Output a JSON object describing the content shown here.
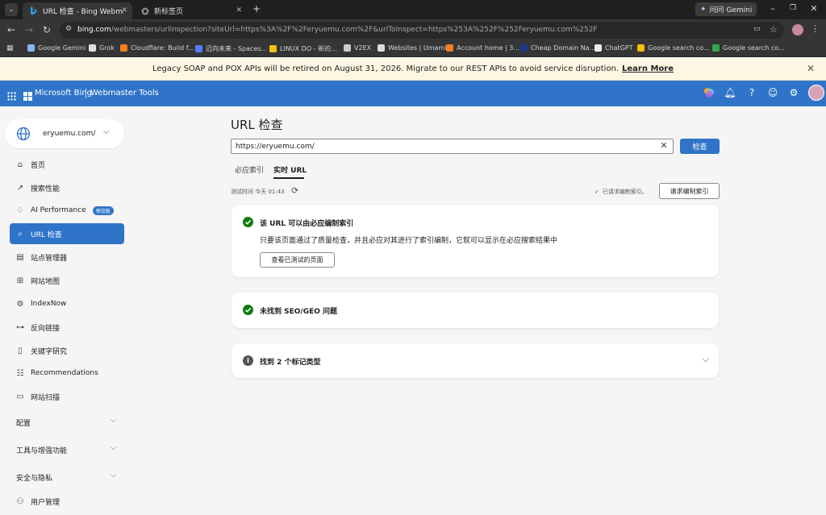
{
  "browser": {
    "tabs": [
      {
        "title": "URL 检查 - Bing Webmaster T",
        "active": true
      },
      {
        "title": "新标签页",
        "active": false
      }
    ],
    "new_tab": "+",
    "gemini_chip": "问问 Gemini",
    "address": {
      "host": "bing.com",
      "rest": "/webmasters/urlinspection?siteUrl=https%3A%2F%2Feryuemu.com%2F&urlToInspect=https%253A%252F%252Feryuemu.com%252F"
    },
    "bookmarks": [
      {
        "label": "Google Gemini",
        "color": "#8ab4f8"
      },
      {
        "label": "Grok",
        "color": "#e0e0e0"
      },
      {
        "label": "Cloudflare: Build f...",
        "color": "#f38020"
      },
      {
        "label": "迈向未来 - Spaces...",
        "color": "#5b7cfa"
      },
      {
        "label": "LINUX DO - 新的...",
        "color": "#f0c419"
      },
      {
        "label": "V2EX",
        "color": "#cccccc"
      },
      {
        "label": "Websites | Umami",
        "color": "#dddddd"
      },
      {
        "label": "Account home | 3...",
        "color": "#f38020"
      },
      {
        "label": "Cheap Domain Na...",
        "color": "#1e3a8a"
      },
      {
        "label": "ChatGPT",
        "color": "#eeeeee"
      },
      {
        "label": "Google search co...",
        "color": "#fbbc05"
      },
      {
        "label": "Google search co...",
        "color": "#34a853"
      }
    ]
  },
  "banner": {
    "text": "Legacy SOAP and POX APIs will be retired on August 31, 2026. Migrate to our REST APIs to avoid service disruption.",
    "link": "Learn More"
  },
  "appbar": {
    "brand": "Microsoft Bing",
    "product": "Webmaster Tools"
  },
  "sidebar": {
    "site": "eryuemu.com/",
    "items": [
      {
        "label": "首页",
        "icon": "home-icon"
      },
      {
        "label": "搜索性能",
        "icon": "trend-icon"
      },
      {
        "label": "AI Performance",
        "icon": "bulb-icon",
        "badge": "预览版"
      },
      {
        "label": "URL 检查",
        "icon": "search-icon",
        "active": true
      },
      {
        "label": "站点管理器",
        "icon": "sitemanager-icon"
      },
      {
        "label": "网站地图",
        "icon": "sitemap-icon"
      },
      {
        "label": "IndexNow",
        "icon": "gear-icon"
      },
      {
        "label": "反向链接",
        "icon": "link-icon"
      },
      {
        "label": "关键字研究",
        "icon": "document-icon"
      },
      {
        "label": "Recommendations",
        "icon": "checklist-icon"
      },
      {
        "label": "网站扫描",
        "icon": "scan-icon"
      }
    ],
    "groups": [
      {
        "label": "配置"
      },
      {
        "label": "工具与增强功能"
      },
      {
        "label": "安全与隐私"
      }
    ],
    "last_item": {
      "label": "用户管理",
      "icon": "user-icon"
    }
  },
  "main": {
    "title": "URL 检查",
    "url_value": "https://eryuemu.com/",
    "inspect_button": "检查",
    "tabs": [
      {
        "label": "必应索引",
        "active": false
      },
      {
        "label": "实时 URL",
        "active": true
      }
    ],
    "test_time": "测试时间 今天 01:43",
    "requested_note": "已请求编制索引。",
    "request_index_button": "请求编制索引",
    "cards": {
      "indexable": {
        "title": "该 URL 可以由必应编制索引",
        "desc": "只要该页面通过了质量检查，并且必应对其进行了索引编制，它就可以显示在必应搜索结果中",
        "button": "查看已测试的页面"
      },
      "seo": {
        "title": "未找到 SEO/GEO 问题"
      },
      "markup": {
        "title": "找到 2 个标记类型"
      }
    }
  }
}
